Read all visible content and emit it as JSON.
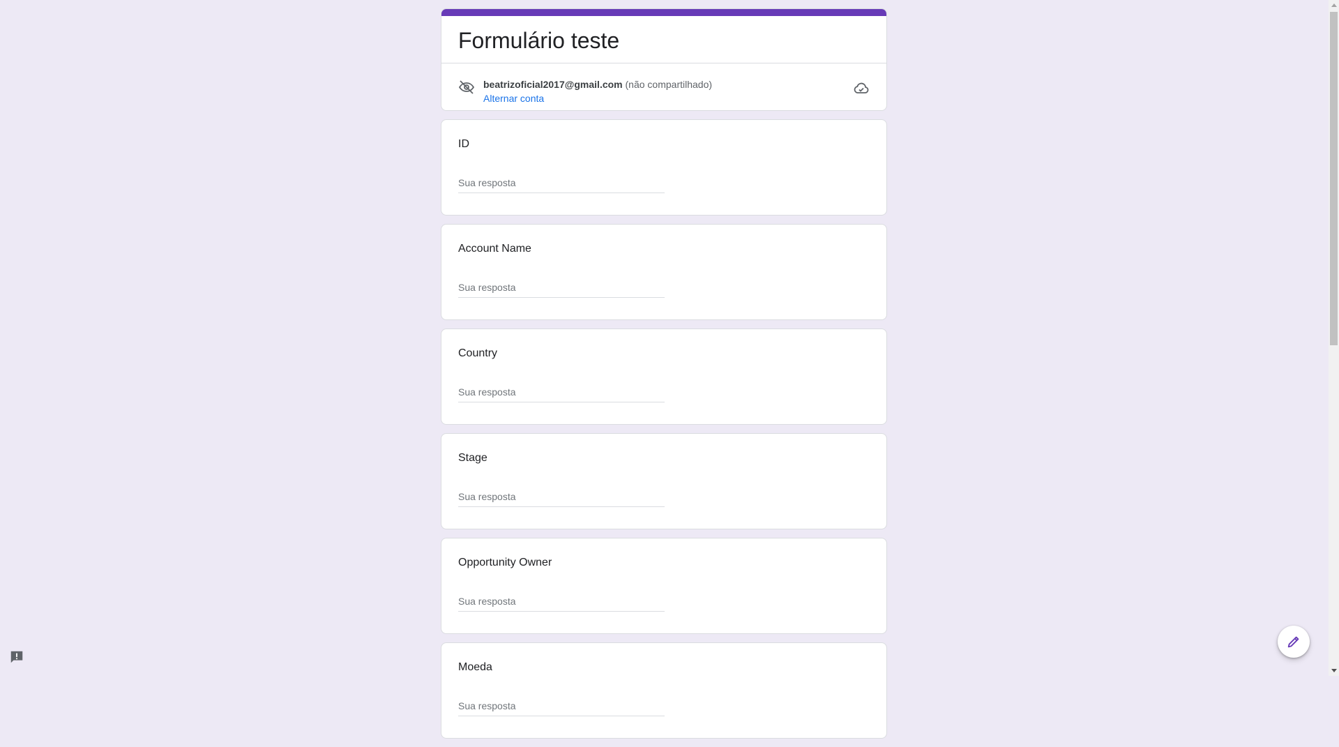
{
  "form": {
    "title": "Formulário teste",
    "account": {
      "email": "beatrizoficial2017@gmail.com",
      "sharing_status": "(não compartilhado)",
      "switch_label": "Alternar conta",
      "icon": "eye-off-icon",
      "status_icon": "cloud-done-icon"
    },
    "accent_color": "#673ab7",
    "link_color": "#1a73e8"
  },
  "questions": [
    {
      "label": "ID",
      "placeholder": "Sua resposta",
      "value": ""
    },
    {
      "label": "Account Name",
      "placeholder": "Sua resposta",
      "value": ""
    },
    {
      "label": "Country",
      "placeholder": "Sua resposta",
      "value": ""
    },
    {
      "label": "Stage",
      "placeholder": "Sua resposta",
      "value": ""
    },
    {
      "label": "Opportunity Owner",
      "placeholder": "Sua resposta",
      "value": ""
    },
    {
      "label": "Moeda",
      "placeholder": "Sua resposta",
      "value": ""
    }
  ],
  "fab": {
    "icon": "pencil-icon"
  },
  "feedback": {
    "icon": "feedback-icon"
  }
}
